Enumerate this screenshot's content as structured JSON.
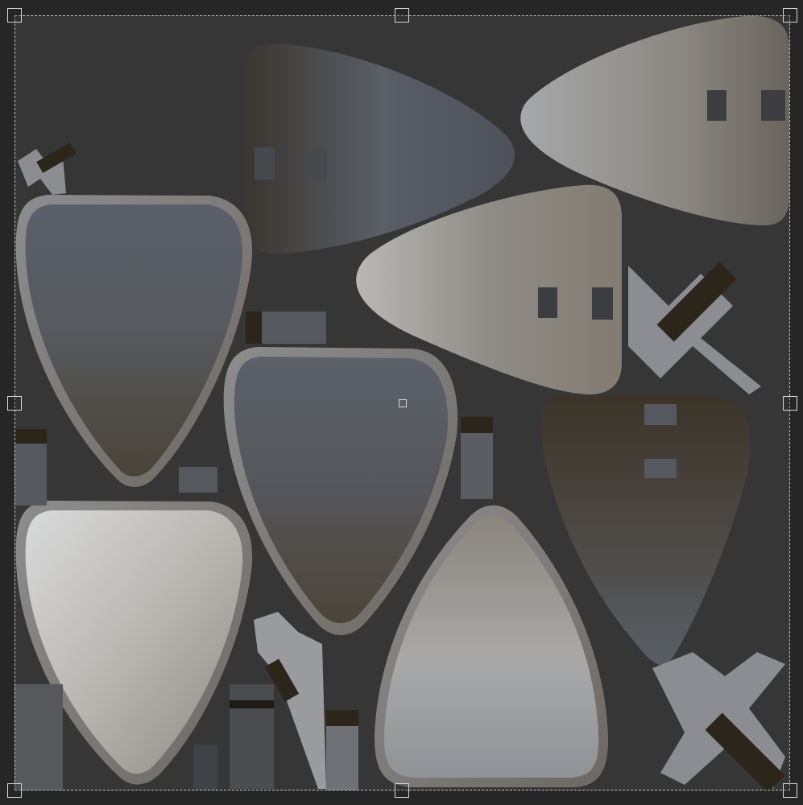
{
  "editor": {
    "view": "texture-uv-editor",
    "background_color": "#262626",
    "texture_background_color": "#363636",
    "selection_color": "#bdbdbd",
    "handles": [
      "top-left",
      "top-center",
      "top-right",
      "middle-left",
      "middle-right",
      "bottom-left",
      "bottom-center",
      "bottom-right"
    ]
  },
  "texture": {
    "islands": [
      {
        "kind": "guitar-pick-outline",
        "shade": "blue-gray"
      },
      {
        "kind": "guitar-pick-outline",
        "shade": "gray-brown"
      },
      {
        "kind": "guitar-pick-outline",
        "shade": "light-silver"
      },
      {
        "kind": "guitar-pick-outline",
        "shade": "silver"
      },
      {
        "kind": "guitar-pick-flat",
        "shade": "dark-brown"
      },
      {
        "kind": "guitar-pick-flat",
        "shade": "silver"
      },
      {
        "kind": "guitar-pick-flat",
        "shade": "warm-gray"
      },
      {
        "kind": "guitar-pick-flat",
        "shade": "brown"
      },
      {
        "kind": "hardware-strip",
        "shade": "mixed"
      }
    ]
  }
}
